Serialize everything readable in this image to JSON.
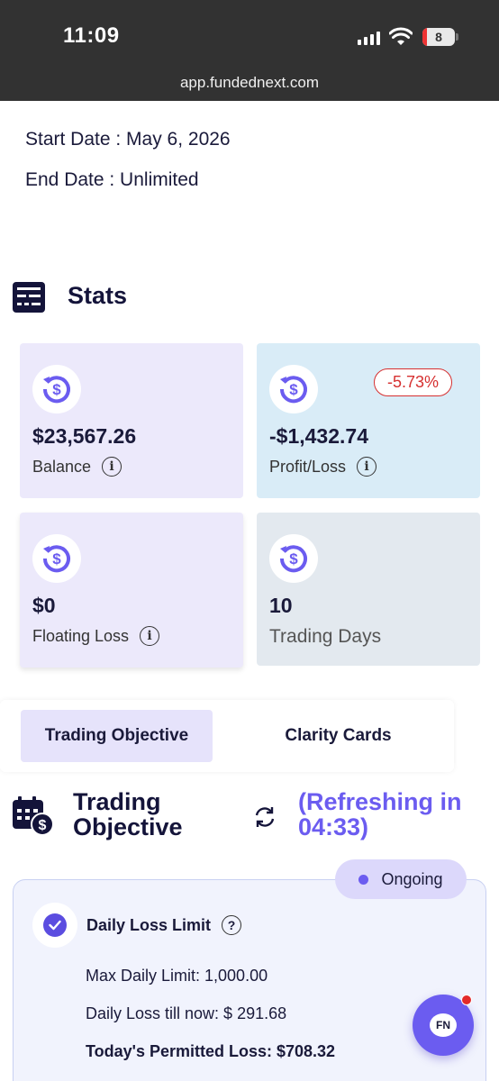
{
  "status_bar": {
    "time": "11:09",
    "battery": "8",
    "url": "app.fundednext.com"
  },
  "dates": {
    "start": "Start Date : May 6, 2026",
    "end": "End Date : Unlimited"
  },
  "stats": {
    "title": "Stats",
    "cards": [
      {
        "value": "$23,567.26",
        "label": "Balance",
        "bg": "#ece9fb"
      },
      {
        "value": "-$1,432.74",
        "label": "Profit/Loss",
        "badge": "-5.73%",
        "bg": "#d9ecf7"
      },
      {
        "value": "$0",
        "label": "Floating Loss",
        "bg": "#ece9fb"
      },
      {
        "value": "10",
        "label": "Trading Days",
        "bg": "#e3e9ef"
      }
    ]
  },
  "tabs": {
    "items": [
      "Trading Objective",
      "Clarity Cards"
    ],
    "active": "Trading Objective"
  },
  "objective": {
    "title": "Trading Objective",
    "refresh": "(Refreshing in 04:33)",
    "status": "Ongoing",
    "daily_loss": {
      "title": "Daily Loss Limit",
      "max_limit": "Max Daily Limit: 1,000.00",
      "loss_till_now": "Daily Loss till now: $ 291.68",
      "permitted": "Today's Permitted Loss: $708.32"
    }
  },
  "chat": {
    "label": "FN"
  },
  "colors": {
    "accent": "#6b5cf0",
    "negative": "#d63030",
    "status_bar": "#323232"
  }
}
